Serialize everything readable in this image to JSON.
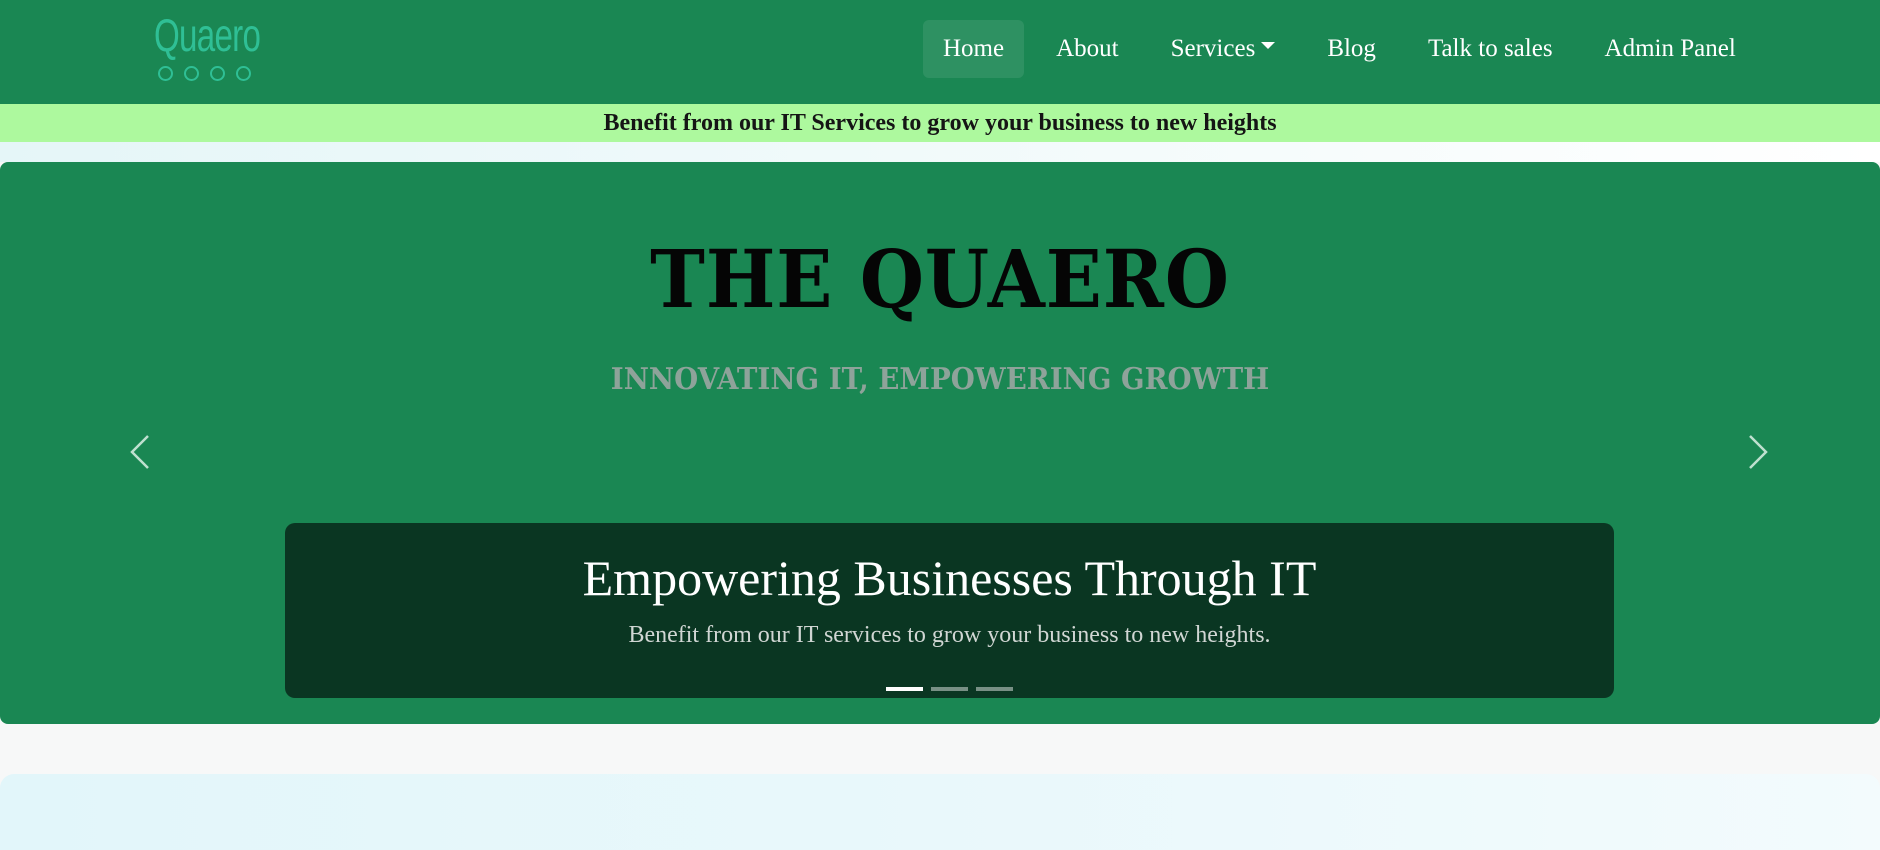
{
  "brand": {
    "logo_text": "Quaero",
    "logo_icon": "four-circles-icon"
  },
  "nav": {
    "items": [
      {
        "label": "Home",
        "active": true
      },
      {
        "label": "About",
        "active": false
      },
      {
        "label": "Services",
        "active": false,
        "dropdown": true
      },
      {
        "label": "Blog",
        "active": false
      },
      {
        "label": "Talk to sales",
        "active": false
      },
      {
        "label": "Admin Panel",
        "active": false
      }
    ]
  },
  "announcement": {
    "text": "Benefit from our IT Services to grow your business to new heights"
  },
  "hero": {
    "title": "THE QUAERO",
    "tagline": "INNOVATING IT, EMPOWERING GROWTH",
    "prev_icon": "chevron-left-icon",
    "next_icon": "chevron-right-icon",
    "caption": {
      "heading": "Empowering Businesses Through IT",
      "text": "Benefit from our IT services to grow your business to new heights."
    },
    "slides_count": 3,
    "active_slide": 1
  },
  "colors": {
    "nav_bg": "#1a8753",
    "announce_bg": "#adf99e",
    "caption_bg": "#0a3622",
    "logo_accent": "#2fbf95"
  }
}
